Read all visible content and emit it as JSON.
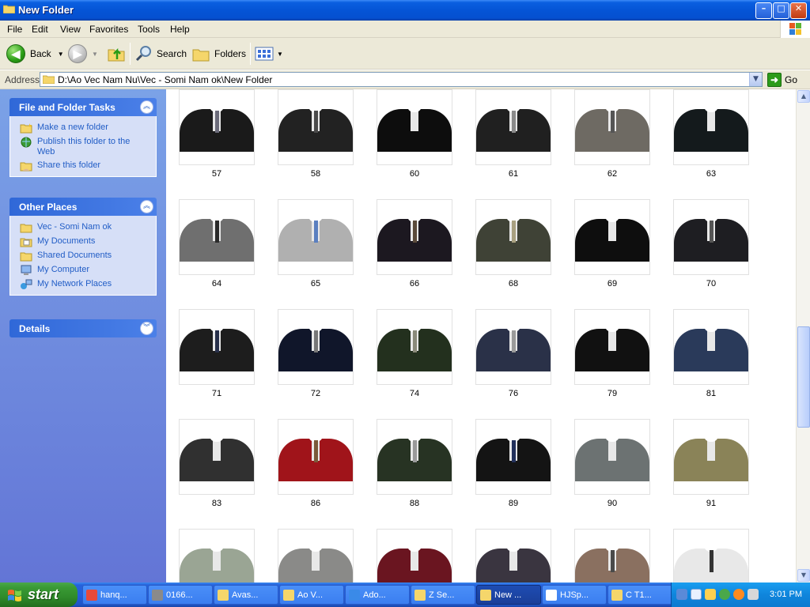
{
  "window": {
    "title": "New Folder",
    "buttons": {
      "minimize": "–",
      "maximize": "□",
      "close": "✕"
    }
  },
  "menu": {
    "items": [
      "File",
      "Edit",
      "View",
      "Favorites",
      "Tools",
      "Help"
    ]
  },
  "toolbar": {
    "back_label": "Back",
    "search_label": "Search",
    "folders_label": "Folders"
  },
  "address": {
    "label": "Address",
    "path": "D:\\Ao Vec Nam Nu\\Vec - Somi Nam ok\\New Folder",
    "go_label": "Go"
  },
  "tasks": {
    "title": "File and Folder Tasks",
    "items": [
      "Make a new folder",
      "Publish this folder to the Web",
      "Share this folder"
    ]
  },
  "other_places": {
    "title": "Other Places",
    "items": [
      "Vec - Somi Nam ok",
      "My Documents",
      "Shared Documents",
      "My Computer",
      "My Network Places"
    ]
  },
  "details": {
    "title": "Details"
  },
  "thumbnails": [
    {
      "label": "57",
      "suit": "#1a1a1a",
      "tie": "#6b6b7a"
    },
    {
      "label": "58",
      "suit": "#222222",
      "tie": "#4a4a4a"
    },
    {
      "label": "60",
      "suit": "#0d0d0d",
      "tie": ""
    },
    {
      "label": "61",
      "suit": "#202020",
      "tie": "#8a8a8a"
    },
    {
      "label": "62",
      "suit": "#6e6a63",
      "tie": "#555555"
    },
    {
      "label": "63",
      "suit": "#141a1c",
      "tie": ""
    },
    {
      "label": "64",
      "suit": "#6f6f6f",
      "tie": "#2a2a2a"
    },
    {
      "label": "65",
      "suit": "#b0b0b0",
      "tie": "#5a7fc0"
    },
    {
      "label": "66",
      "suit": "#1c1820",
      "tie": "#5a4a3a"
    },
    {
      "label": "68",
      "suit": "#3f4236",
      "tie": "#a8a080"
    },
    {
      "label": "69",
      "suit": "#0e0e0e",
      "tie": ""
    },
    {
      "label": "70",
      "suit": "#1e1e22",
      "tie": "#555555"
    },
    {
      "label": "71",
      "suit": "#1d1d1d",
      "tie": "#28304a"
    },
    {
      "label": "72",
      "suit": "#10162a",
      "tie": "#777777"
    },
    {
      "label": "74",
      "suit": "#23301e",
      "tie": "#8a8a7a"
    },
    {
      "label": "76",
      "suit": "#2a3148",
      "tie": "#9a9a9a"
    },
    {
      "label": "79",
      "suit": "#111111",
      "tie": ""
    },
    {
      "label": "81",
      "suit": "#2a3a5a",
      "tie": ""
    },
    {
      "label": "83",
      "suit": "#303030",
      "tie": ""
    },
    {
      "label": "86",
      "suit": "#a0141a",
      "tie": "#7a5a3a"
    },
    {
      "label": "88",
      "suit": "#273323",
      "tie": "#9a9a9a"
    },
    {
      "label": "89",
      "suit": "#141414",
      "tie": "#22305a"
    },
    {
      "label": "90",
      "suit": "#6c7272",
      "tie": ""
    },
    {
      "label": "91",
      "suit": "#8a8358",
      "tie": ""
    },
    {
      "label": "",
      "suit": "#9aa594",
      "tie": ""
    },
    {
      "label": "",
      "suit": "#8a8a88",
      "tie": ""
    },
    {
      "label": "",
      "suit": "#6a1520",
      "tie": ""
    },
    {
      "label": "",
      "suit": "#3a3540",
      "tie": ""
    },
    {
      "label": "",
      "suit": "#8a7060",
      "tie": "#4a4a4a"
    },
    {
      "label": "",
      "suit": "#e8e8e8",
      "tie": "#333333"
    }
  ],
  "taskbar": {
    "start_label": "start",
    "buttons": [
      "hanq...",
      "0166...",
      "Avas...",
      "Ao V...",
      "Ado...",
      "Z Se...",
      "New ...",
      "HJSp...",
      "C T1..."
    ],
    "active_index": 6,
    "clock": "3:01 PM"
  },
  "colors": {
    "accent": "#215dc6",
    "title_bar": "#0554d6",
    "taskbar": "#245edb",
    "start_green": "#3a9a35"
  }
}
